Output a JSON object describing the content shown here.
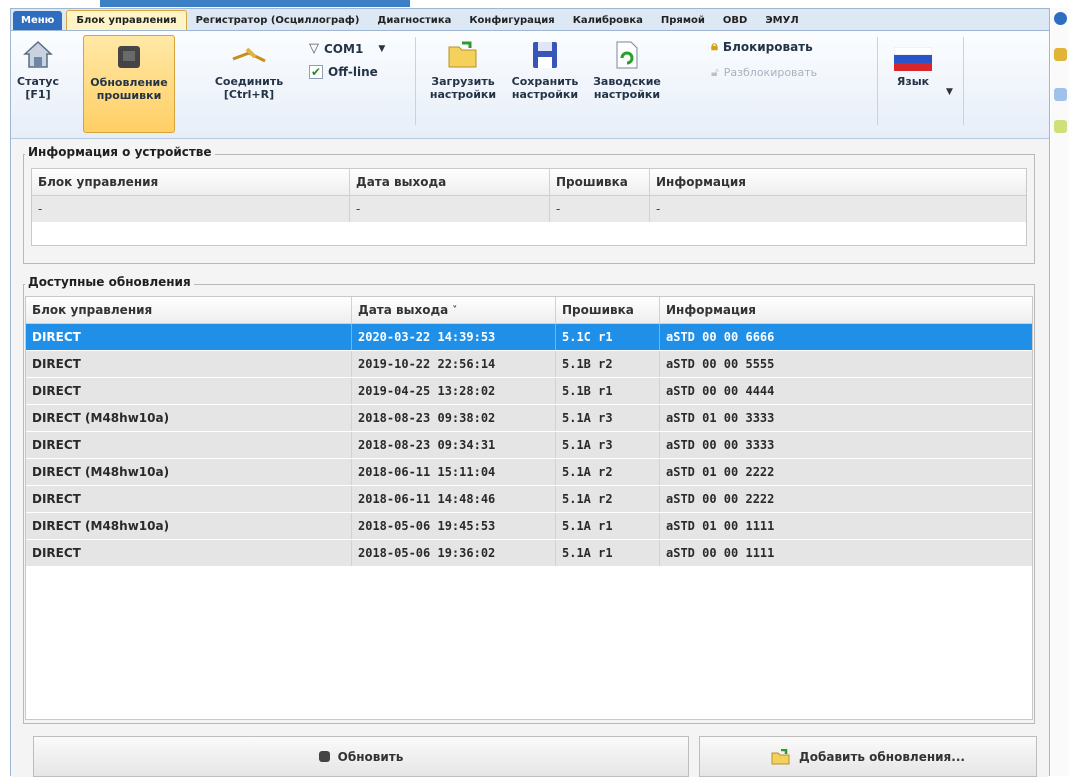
{
  "menu_tabs": [
    "Меню",
    "Блок управления",
    "Регистратор (Осциллограф)",
    "Диагностика",
    "Конфигурация",
    "Калибровка",
    "Прямой",
    "OBD",
    "ЭМУЛ"
  ],
  "ribbon": {
    "status": {
      "line1": "Статус",
      "line2": "[F1]"
    },
    "update_firmware": {
      "line1": "Обновление",
      "line2": "прошивки"
    },
    "connect": {
      "line1": "Соединить",
      "line2": "[Ctrl+R]"
    },
    "port": "COM1",
    "offline": "Off-line",
    "load_settings": {
      "line1": "Загрузить",
      "line2": "настройки"
    },
    "save_settings": {
      "line1": "Сохранить",
      "line2": "настройки"
    },
    "factory_settings": {
      "line1": "Заводские",
      "line2": "настройки"
    },
    "lock": "Блокировать",
    "unlock": "Разблокировать",
    "language": "Язык"
  },
  "device_info": {
    "title": "Информация о устройстве",
    "columns": [
      "Блок управления",
      "Дата выхода",
      "Прошивка",
      "Информация"
    ],
    "row": [
      "-",
      "-",
      "-",
      "-"
    ]
  },
  "updates": {
    "title": "Доступные обновления",
    "columns": [
      "Блок управления",
      "Дата выхода",
      "Прошивка",
      "Информация"
    ],
    "sort_indicator": "˅",
    "rows": [
      [
        "DIRECT",
        "2020-03-22 14:39:53",
        "5.1C r1",
        "aSTD 00 00 6666"
      ],
      [
        "DIRECT",
        "2019-10-22 22:56:14",
        "5.1B r2",
        "aSTD 00 00 5555"
      ],
      [
        "DIRECT",
        "2019-04-25 13:28:02",
        "5.1B r1",
        "aSTD 00 00 4444"
      ],
      [
        "DIRECT   (M48hw10a)",
        "2018-08-23 09:38:02",
        "5.1A r3",
        "aSTD 01 00 3333"
      ],
      [
        "DIRECT",
        "2018-08-23 09:34:31",
        "5.1A r3",
        "aSTD 00 00 3333"
      ],
      [
        "DIRECT   (M48hw10a)",
        "2018-06-11 15:11:04",
        "5.1A r2",
        "aSTD 01 00 2222"
      ],
      [
        "DIRECT",
        "2018-06-11 14:48:46",
        "5.1A r2",
        "aSTD 00 00 2222"
      ],
      [
        "DIRECT   (M48hw10a)",
        "2018-05-06 19:45:53",
        "5.1A r1",
        "aSTD 01 00 1111"
      ],
      [
        "DIRECT",
        "2018-05-06 19:36:02",
        "5.1A r1",
        "aSTD 00 00 1111"
      ]
    ]
  },
  "buttons": {
    "refresh": "Обновить",
    "add_updates": "Добавить обновления..."
  },
  "colors": {
    "selection": "#1f8fe8",
    "accent": "#2e6dc0",
    "active_tab": "#ffcf65"
  }
}
